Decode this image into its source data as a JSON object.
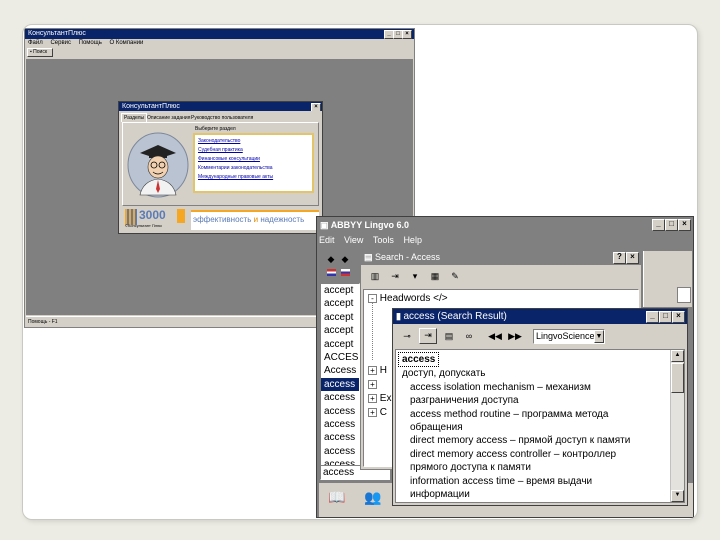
{
  "konsultant_app": {
    "title": "КонсультантПлюс",
    "menu": [
      "Файл",
      "Сервис",
      "Помощь",
      "О Компании"
    ],
    "toolbar_button": "Поиск",
    "status_left": "Помощь - F1",
    "dialog": {
      "title": "КонсультантПлюс",
      "tabs": [
        "Разделы",
        "Описание задания",
        "Руководство пользователя"
      ],
      "section_prompt": "Выберите раздел",
      "links": [
        "Законодательство",
        "Судебная практика",
        "Финансовые консультации",
        "Комментарии законодательства",
        "Международные правовые акты"
      ],
      "brand_caption": "©Консультант Плюс",
      "logo_number": "3000",
      "slogan_part1": "эффективность",
      "slogan_and": "и",
      "slogan_part2": "надежность"
    }
  },
  "lingvo": {
    "title": "ABBYY Lingvo 6.0",
    "menu": [
      "Edit",
      "View",
      "Tools",
      "Help"
    ],
    "word_list": [
      "accept",
      "accept",
      "accept",
      "accept",
      "accept",
      "ACCES",
      "Access",
      "access",
      "access",
      "access",
      "access",
      "access",
      "access",
      "access"
    ],
    "selected_index": 7,
    "input_value": "access",
    "search_window": {
      "title": "Search - Access",
      "tree": [
        {
          "toggle": "-",
          "text": "Headwords </>"
        },
        {
          "toggle": "+",
          "text": "H"
        },
        {
          "toggle": "+",
          "text": ""
        },
        {
          "toggle": "+",
          "text": "Ex"
        },
        {
          "toggle": "+",
          "text": "C"
        }
      ]
    },
    "result_window": {
      "title": "access (Search Result)",
      "dictionary": "LingvoScience-R",
      "headword": "access",
      "translation": "доступ, допускать",
      "entries": [
        "access isolation mechanism – механизм",
        "разграничения доступа",
        "access method routine – программа метода",
        "обращения",
        "direct memory access – прямой доступ к памяти",
        "direct memory access controller – контроллер",
        "прямого доступа к памяти",
        "information access time – время выдачи",
        "информации"
      ]
    }
  },
  "colors": {
    "titlebar": "#0a246a",
    "window_face": "#d4d0c8",
    "desktop_gray": "#808080",
    "orange_accent": "#f5a623"
  }
}
